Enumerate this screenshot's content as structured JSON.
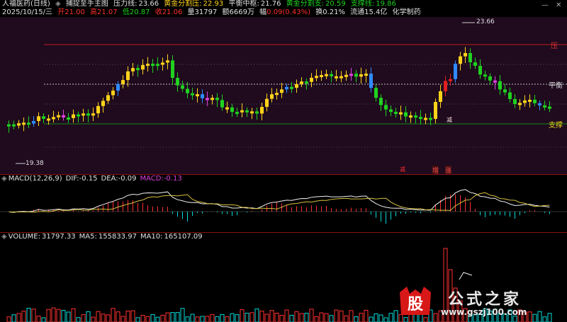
{
  "header": {
    "stock_name": "人福医药(日线)",
    "formula_name": "捕捉至手主图",
    "pressure_label": "压力线:",
    "pressure_value": "23.66",
    "gold_press_label": "黄金分割压:",
    "gold_press_value": "22.93",
    "balance_label": "平衡中枢:",
    "balance_value": "21.76",
    "gold_support_label": "黄金分割支:",
    "gold_support_value": "20.59",
    "support_label": "支撑线:",
    "support_value": "19.86",
    "date": "2025/10/15/三",
    "open_label": "开",
    "open": "21.00",
    "high_label": "高",
    "high": "21.07",
    "low_label": "低",
    "low": "20.87",
    "close_label": "收",
    "close": "21.06",
    "vol_label": "量",
    "vol": "31797",
    "amount_label": "额",
    "amount": "6669万",
    "change_label": "幅",
    "change": "0.09(0.43%)",
    "turnover_label": "换",
    "turnover": "0.21%",
    "float_label": "流通",
    "float": "15.4亿",
    "industry": "化学制药"
  },
  "controls": {
    "min_label": "—",
    "close_label": "✕"
  },
  "main_chart": {
    "pressure_text": "压",
    "balance_text": "平衡",
    "support_text": "支撑",
    "high_marker": "23.66",
    "low_marker": "19.38",
    "signal_a": "减",
    "signal_b": "增",
    "signal_c": "涨",
    "signal_d": "减"
  },
  "macd": {
    "title": "MACD(12,26,9)",
    "dif_label": "DIF:",
    "dif": "-0.15",
    "dea_label": "DEA:",
    "dea": "-0.09",
    "macd_label": "MACD:",
    "macd": "-0.13"
  },
  "volume": {
    "title": "VOLUME:",
    "value": "31797.33",
    "ma5_label": "MA5:",
    "ma5": "155833.97",
    "ma10_label": "MA10:",
    "ma10": "165107.09"
  },
  "watermark": {
    "glyph": "股",
    "text": "公式之家",
    "url": "www.gszj100.com"
  },
  "colors": {
    "up": "#ff3030",
    "down": "#00d8d8",
    "yellow_candle": "#ffd21a",
    "blue_candle": "#2f8bff",
    "green_candle": "#1fd21f",
    "magenta_candle": "#e040e0",
    "pressure_line": "#c02020",
    "support_line": "#1a8a1a"
  }
}
